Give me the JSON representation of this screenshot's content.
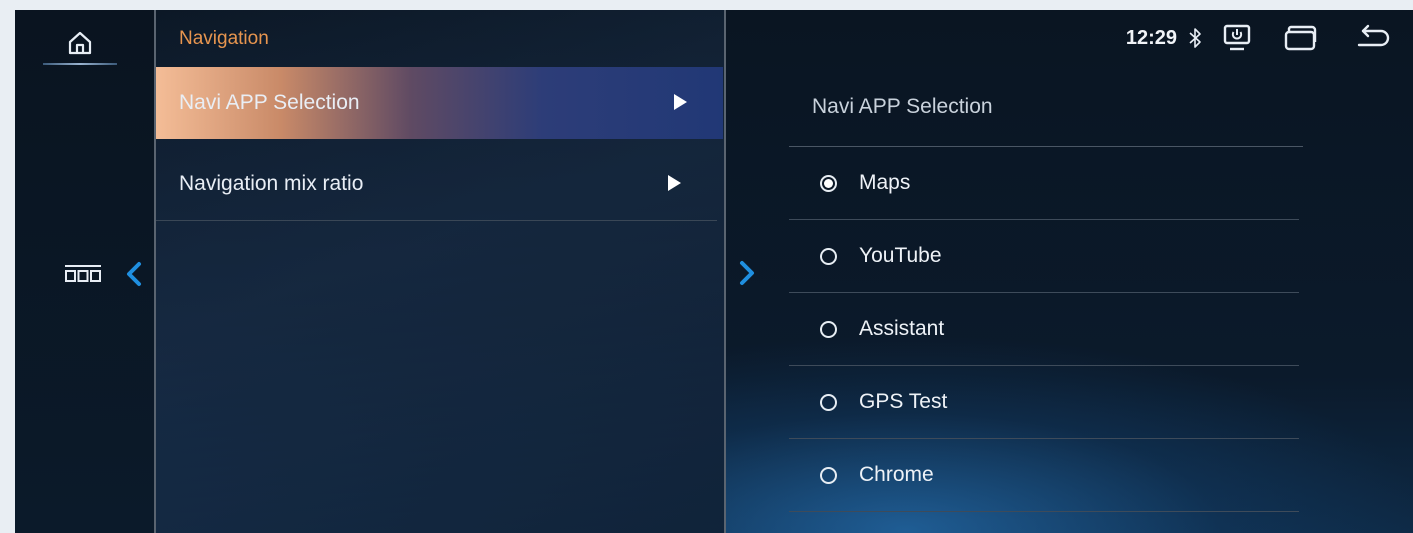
{
  "rail": {
    "icons": [
      "home-icon",
      "apps-icon",
      "chevron-left-icon"
    ]
  },
  "menu": {
    "title": "Navigation",
    "items": [
      {
        "label": "Navi APP Selection",
        "selected": true
      },
      {
        "label": "Navigation mix ratio",
        "selected": false
      }
    ]
  },
  "status": {
    "time": "12:29",
    "icons": [
      "bluetooth-icon",
      "screen-cast-icon",
      "windows-icon",
      "back-icon"
    ]
  },
  "panel": {
    "title": "Navi APP Selection",
    "options": [
      {
        "label": "Maps",
        "checked": true
      },
      {
        "label": "YouTube",
        "checked": false
      },
      {
        "label": "Assistant",
        "checked": false
      },
      {
        "label": "GPS Test",
        "checked": false
      },
      {
        "label": "Chrome",
        "checked": false
      }
    ]
  },
  "colors": {
    "accent": "#e7954f",
    "chevron": "#1f8fe0",
    "selected_gradient_start": "#f4bd97",
    "selected_gradient_end": "#213876"
  }
}
